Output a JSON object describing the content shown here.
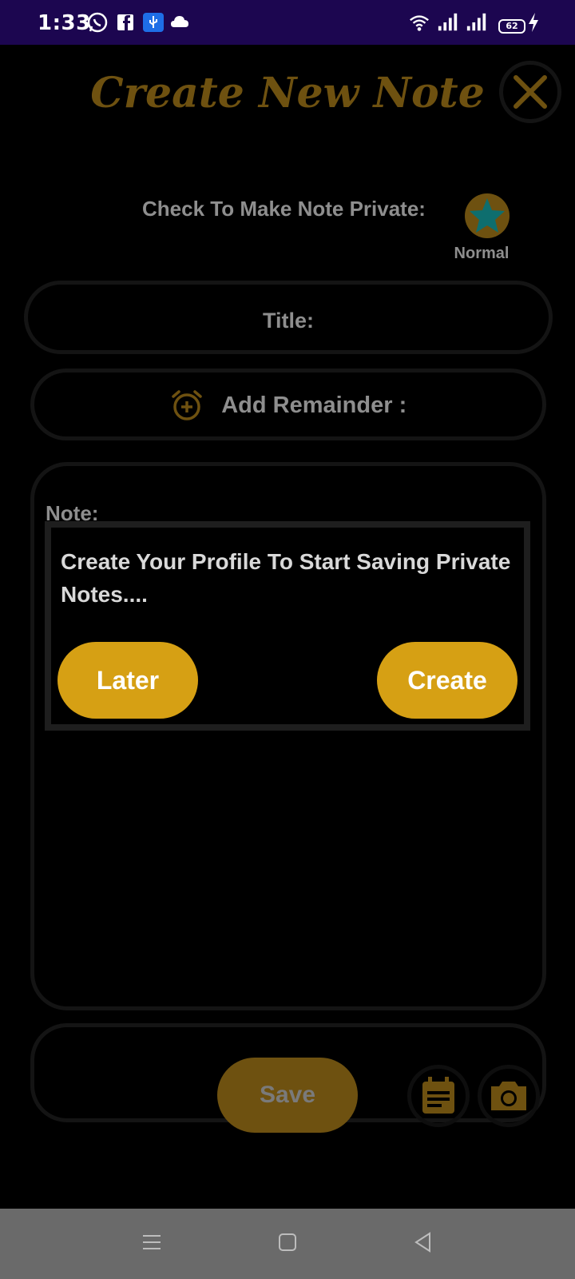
{
  "status_bar": {
    "time": "1:33",
    "battery": "62",
    "icons": [
      "whatsapp-icon",
      "facebook-icon",
      "usb-icon",
      "cloud-icon",
      "wifi-icon",
      "signal-icon",
      "signal-icon",
      "charging-icon"
    ]
  },
  "header": {
    "title": "Create New Note",
    "close_icon": "close-icon"
  },
  "privacy": {
    "label": "Check To Make Note Private:",
    "state_label": "Normal",
    "icon": "star-icon"
  },
  "form": {
    "title_label": "Title:",
    "remainder_label": "Add Remainder :",
    "note_label": "Note:"
  },
  "toolbar": {
    "save_label": "Save",
    "icons": [
      "calendar-icon",
      "camera-icon"
    ]
  },
  "dialog": {
    "message": "Create Your Profile To Start Saving Private Notes....",
    "later_label": "Later",
    "create_label": "Create"
  },
  "navbar": {
    "icons": [
      "menu-icon",
      "home-icon",
      "back-icon"
    ]
  },
  "colors": {
    "accent": "#d6a014",
    "accent_dim": "#6e5110",
    "star": "#0e6e6e",
    "status_bar": "#1c0650",
    "nav_bar": "#6a6a6a"
  }
}
